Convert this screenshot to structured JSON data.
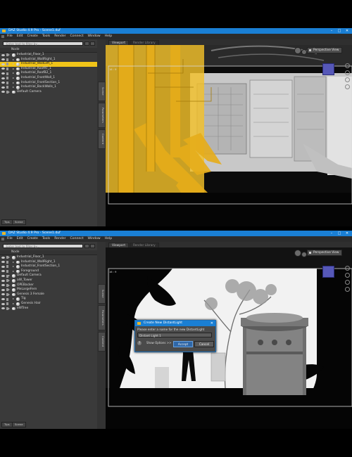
{
  "window": {
    "title_top": "DAZ Studio 4.9 Pro - Scene1.duf",
    "title_bottom": "DAZ Studio 4.9 Pro - Scene1.duf",
    "controls": [
      "–",
      "□",
      "✕"
    ]
  },
  "menu": [
    "File",
    "Edit",
    "Create",
    "Tools",
    "Render",
    "Connect",
    "Window",
    "Help"
  ],
  "scene_pane": {
    "search_placeholder": "Enter text to filter by...",
    "header": "Node",
    "top_rows": [
      {
        "label": "Industrial_Floor_1",
        "level": 1,
        "selected": false
      },
      {
        "label": "Industrial_WallRight_1",
        "level": 2,
        "selected": false
      },
      {
        "label": "Industrial_WallLeft_1",
        "level": 2,
        "selected": true
      },
      {
        "label": "Industrial_RoofRT_1",
        "level": 2,
        "selected": false
      },
      {
        "label": "Industrial_RoofB2_1",
        "level": 2,
        "selected": false
      },
      {
        "label": "Industrial_FrontWall_1",
        "level": 2,
        "selected": false
      },
      {
        "label": "Industrial_FrontSection_1",
        "level": 2,
        "selected": false
      },
      {
        "label": "Industrial_BackWalls_1",
        "level": 2,
        "selected": false
      },
      {
        "label": "Default Camera",
        "level": 1,
        "selected": false
      }
    ],
    "bottom_rows": [
      {
        "label": "Industrial_Floor_1",
        "level": 1,
        "selected": false
      },
      {
        "label": "Industrial_WallRight_1",
        "level": 2,
        "selected": false
      },
      {
        "label": "Industrial_FrontSection_1",
        "level": 2,
        "selected": false
      },
      {
        "label": "Foreground",
        "level": 2,
        "selected": false
      },
      {
        "label": "Default Camera",
        "level": 1,
        "selected": false
      },
      {
        "label": "aW_Tower",
        "level": 1,
        "selected": false
      },
      {
        "label": "OPEBacker",
        "level": 1,
        "selected": false
      },
      {
        "label": "MeLargeFern",
        "level": 1,
        "selected": false
      },
      {
        "label": "Genesis 3 Female",
        "level": 1,
        "selected": false
      },
      {
        "label": "Tig",
        "level": 2,
        "selected": false
      },
      {
        "label": "Genesis Hair",
        "level": 2,
        "selected": false
      },
      {
        "label": "eWTree",
        "level": 1,
        "selected": false
      }
    ],
    "bottom_tabs": [
      "Tips",
      "Scene"
    ]
  },
  "side_tabs": [
    "Scene",
    "Parameters",
    "Content"
  ],
  "viewport": {
    "tabs": [
      "Viewport",
      "Render Library"
    ],
    "view_mode": "Perspective View",
    "frame_label": "16 : 9"
  },
  "dialog": {
    "title": "Create New DistantLight",
    "prompt": "Please enter a name for the new DistantLight",
    "input_value": "Distant Light 1",
    "help": "?",
    "options_label": "Show Options >>",
    "accept": "Accept",
    "cancel": "Cancel"
  },
  "colors": {
    "title_bar": "#1a7fd4",
    "selection": "#f0c419",
    "panel": "#3c3c3c",
    "nav_cube": "#5658b8"
  }
}
